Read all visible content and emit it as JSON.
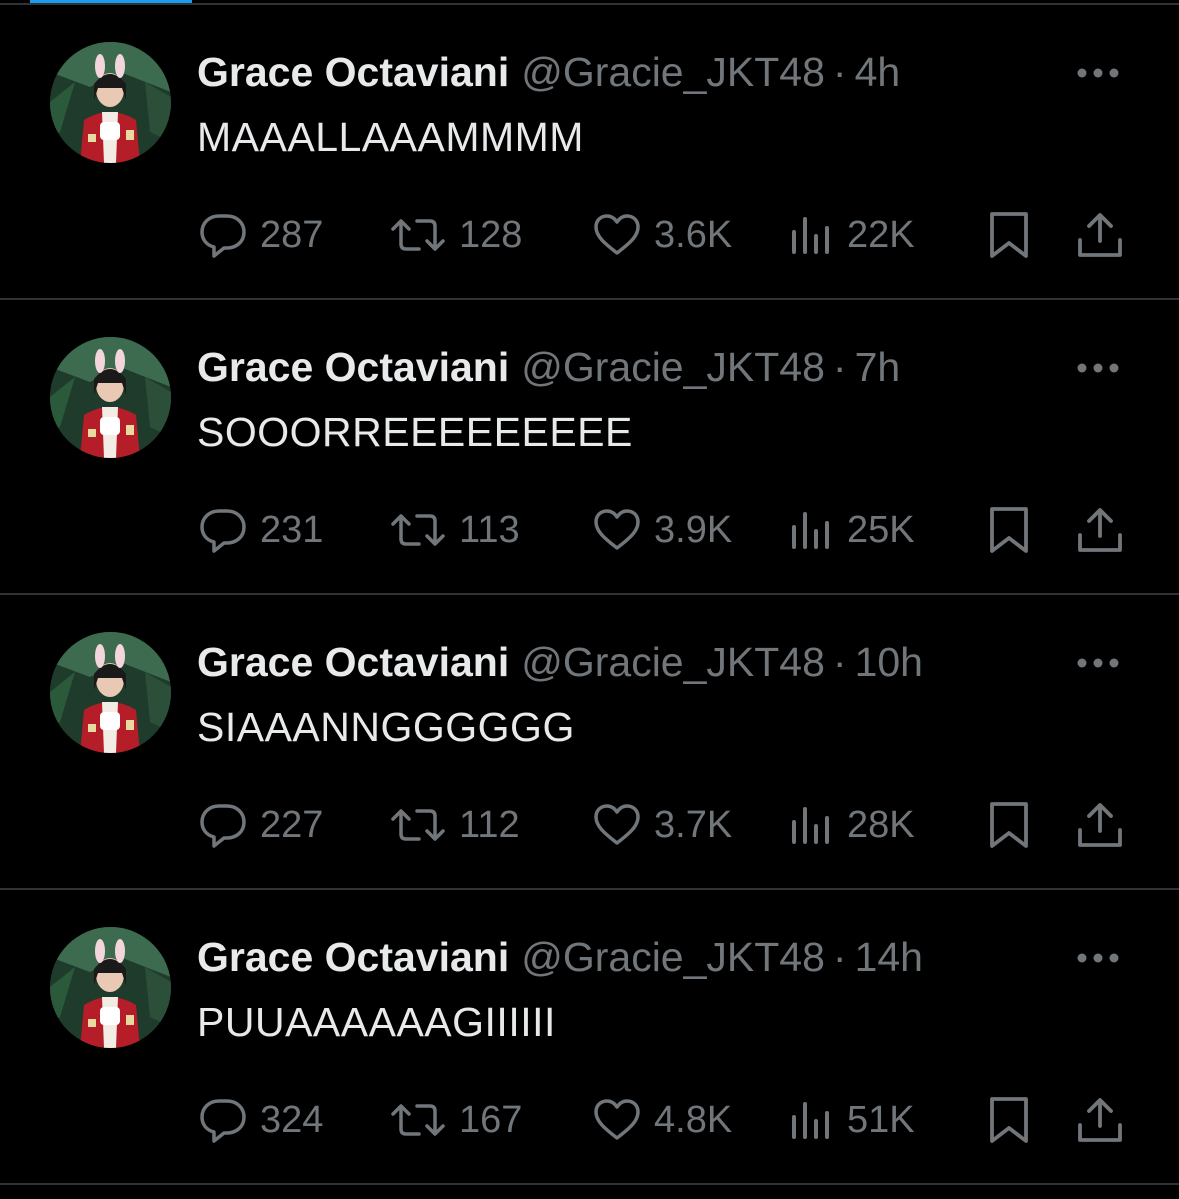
{
  "colors": {
    "background": "#000000",
    "primary_text": "#e7e9ea",
    "secondary_text": "#71767b",
    "divider": "#2f3336",
    "accent": "#1d9bf0"
  },
  "icons": {
    "reply": "speech-bubble-icon",
    "retweet": "retweet-arrows-icon",
    "like": "heart-icon",
    "views": "bar-chart-icon",
    "bookmark": "bookmark-icon",
    "share": "share-upload-icon",
    "more": "more-dots-icon"
  },
  "tweets": [
    {
      "name": "Grace Octaviani",
      "handle": "@Gracie_JKT48",
      "separator": "·",
      "time": "4h",
      "text": "MAAALLAAAMMMM",
      "replies": "287",
      "retweets": "128",
      "likes": "3.6K",
      "views": "22K"
    },
    {
      "name": "Grace Octaviani",
      "handle": "@Gracie_JKT48",
      "separator": "·",
      "time": "7h",
      "text": "SOOORREEEEEEEEE",
      "replies": "231",
      "retweets": "113",
      "likes": "3.9K",
      "views": "25K"
    },
    {
      "name": "Grace Octaviani",
      "handle": "@Gracie_JKT48",
      "separator": "·",
      "time": "10h",
      "text": "SIAAANNGGGGGG",
      "replies": "227",
      "retweets": "112",
      "likes": "3.7K",
      "views": "28K"
    },
    {
      "name": "Grace Octaviani",
      "handle": "@Gracie_JKT48",
      "separator": "·",
      "time": "14h",
      "text": "PUUAAAAAAGIIIIII",
      "replies": "324",
      "retweets": "167",
      "likes": "4.8K",
      "views": "51K"
    }
  ]
}
